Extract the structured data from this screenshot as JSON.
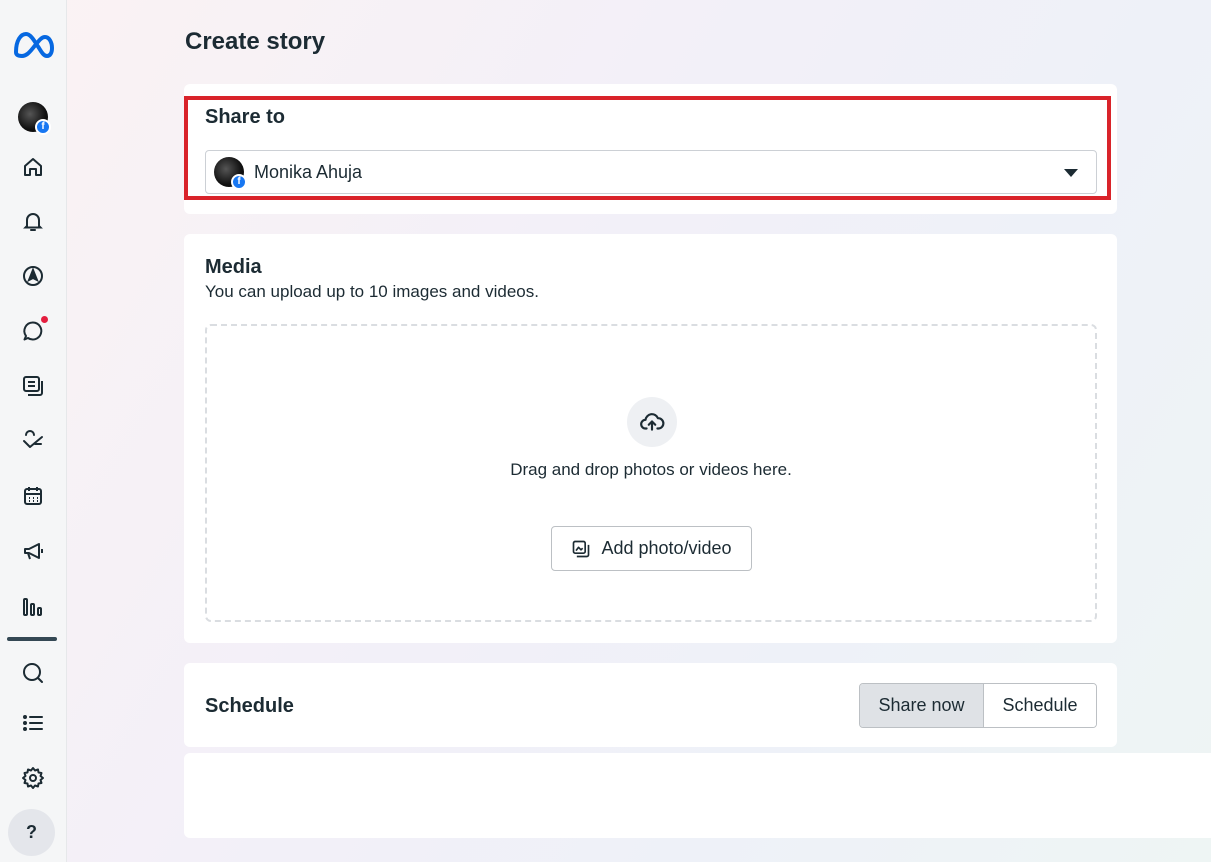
{
  "sidebar": {
    "items": [
      {
        "name": "account-avatar",
        "icon": "avatar-icon"
      },
      {
        "name": "home",
        "icon": "home-icon"
      },
      {
        "name": "notifications",
        "icon": "bell-icon"
      },
      {
        "name": "navigation",
        "icon": "compass-icon"
      },
      {
        "name": "messages",
        "icon": "chat-icon",
        "badge": true
      },
      {
        "name": "content",
        "icon": "content-icon"
      },
      {
        "name": "monetization",
        "icon": "monetization-icon"
      },
      {
        "name": "planner",
        "icon": "calendar-icon"
      },
      {
        "name": "ads",
        "icon": "megaphone-icon"
      },
      {
        "name": "insights",
        "icon": "chart-bar-icon"
      },
      {
        "name": "search",
        "icon": "search-icon"
      },
      {
        "name": "all-tools",
        "icon": "list-icon"
      },
      {
        "name": "settings",
        "icon": "gear-icon"
      }
    ],
    "help_label": "?"
  },
  "page": {
    "title": "Create story"
  },
  "share_to": {
    "title": "Share to",
    "selected": "Monika Ahuja",
    "badge": "f"
  },
  "media": {
    "title": "Media",
    "subtitle": "You can upload up to 10 images and videos.",
    "drop_text": "Drag and drop photos or videos here.",
    "add_button": "Add photo/video"
  },
  "schedule": {
    "title": "Schedule",
    "options": [
      "Share now",
      "Schedule"
    ],
    "selected": "Share now"
  },
  "colors": {
    "accent_highlight": "#d9232a",
    "facebook_blue": "#1877f2",
    "meta_blue": "#0668e1",
    "notification_red": "#e41e3f"
  }
}
